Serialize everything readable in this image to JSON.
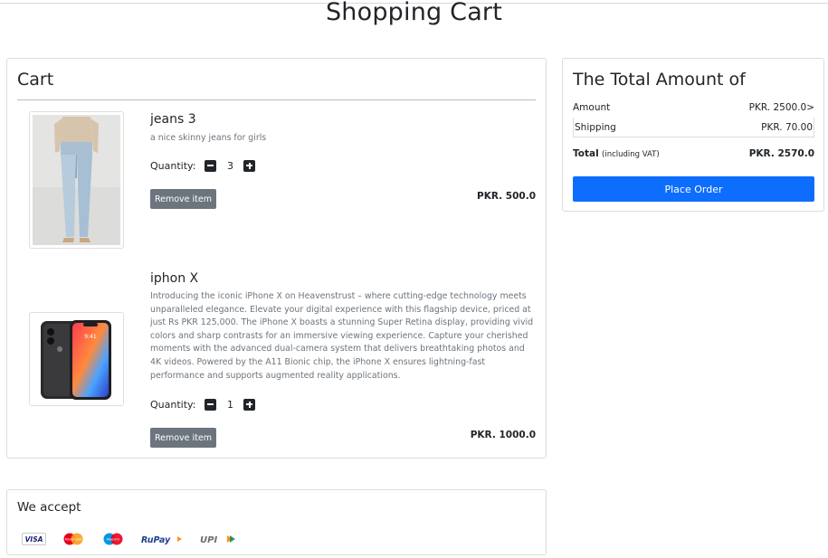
{
  "page": {
    "title": "Shopping Cart"
  },
  "cart": {
    "heading": "Cart",
    "items": [
      {
        "name": "jeans 3",
        "description": "a nice skinny jeans for girls",
        "quantity_label": "Quantity:",
        "quantity": "3",
        "remove_label": "Remove item",
        "price": "PKR. 500.0"
      },
      {
        "name": "iphon X",
        "description": "Introducing the iconic iPhone X on Heavenstrust – where cutting-edge technology meets unparalleled elegance. Elevate your digital experience with this flagship device, priced at just Rs PKR 125,000. The iPhone X boasts a stunning Super Retina display, providing vivid colors and sharp contrasts for an immersive viewing experience. Capture your cherished moments with the advanced dual-camera system that delivers breathtaking photos and 4K videos. Powered by the A11 Bionic chip, the iPhone X ensures lightning-fast performance and supports augmented reality applications.",
        "quantity_label": "Quantity:",
        "quantity": "1",
        "remove_label": "Remove item",
        "price": "PKR. 1000.0"
      }
    ]
  },
  "summary": {
    "heading": "The Total Amount of",
    "amount_label": "Amount",
    "amount_value": "PKR. 2500.0>",
    "shipping_label": "Shipping",
    "shipping_value": "PKR. 70.00",
    "total_label": "Total",
    "total_note": "(including VAT)",
    "total_value": "PKR. 2570.0",
    "place_order_label": "Place Order"
  },
  "payments": {
    "heading": "We accept",
    "methods": [
      "visa",
      "mastercard",
      "maestro",
      "rupay",
      "upi"
    ],
    "visa": "VISA",
    "mastercard": "MasterCard",
    "maestro": "Maestro",
    "rupay": "RuPay",
    "upi": "UPI"
  },
  "colors": {
    "primary": "#0d6efd",
    "secondary": "#6c757d",
    "text": "#212529"
  }
}
